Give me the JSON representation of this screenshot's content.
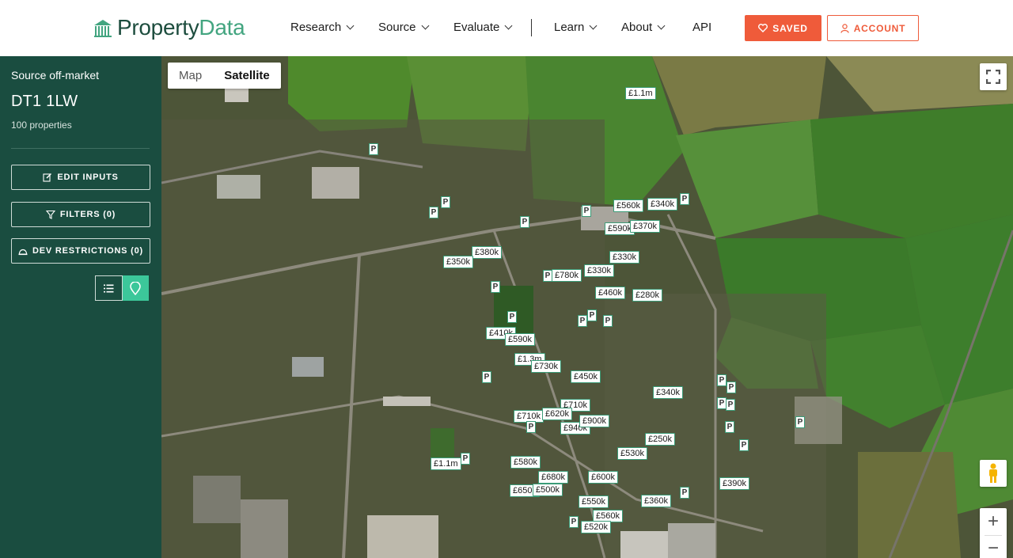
{
  "brand": {
    "name_part1": "Property",
    "name_part2": "Data",
    "accent": "#43a580",
    "dark": "#1d4d3e"
  },
  "nav": {
    "research": "Research",
    "source": "Source",
    "evaluate": "Evaluate",
    "learn": "Learn",
    "about": "About",
    "api": "API"
  },
  "actions": {
    "saved": "SAVED",
    "account": "ACCOUNT",
    "accent_color": "#ef5b3a"
  },
  "sidebar": {
    "kicker": "Source off-market",
    "postcode": "DT1 1LW",
    "count": "100 properties",
    "edit_inputs": "EDIT INPUTS",
    "filters": "FILTERS (0)",
    "dev_restrictions": "DEV RESTRICTIONS (0)",
    "bg_color": "#1a4d40",
    "active_view": "map"
  },
  "map": {
    "type_map": "Map",
    "type_satellite": "Satellite",
    "active_type": "Satellite",
    "zoom_in": "+",
    "zoom_out": "−",
    "price_pins": [
      "£1.1m",
      "£560k",
      "£340k",
      "£590k",
      "£370k",
      "£380k",
      "£350k",
      "£330k",
      "£330k",
      "£780k",
      "£460k",
      "£280k",
      "£410k",
      "£590k",
      "£1.3m",
      "£730k",
      "£450k",
      "£340k",
      "£710k",
      "£710k",
      "£620k",
      "£940k",
      "£900k",
      "£250k",
      "£530k",
      "£1.1m",
      "£580k",
      "£680k",
      "£600k",
      "£650k",
      "£500k",
      "£550k",
      "£560k",
      "£520k",
      "£360k",
      "£390k"
    ],
    "plot_pins_label": "P"
  }
}
